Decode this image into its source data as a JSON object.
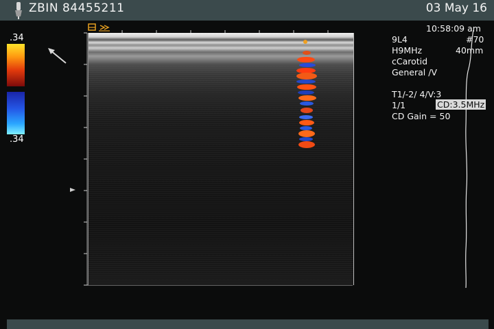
{
  "header": {
    "patient_id": "ZBIN 84455211",
    "date": "03 May 16"
  },
  "color_scale": {
    "top_value": ".34",
    "bottom_value": ".34",
    "hot_colors": [
      "#ffe32a",
      "#ff9a10",
      "#e23a0c",
      "#7c0b0b"
    ],
    "cold_colors": [
      "#1a25a8",
      "#2457e6",
      "#2aa6ff",
      "#7ff0ff"
    ]
  },
  "info_panel": {
    "time": "10:58:09 am",
    "probe": "9L4",
    "frame": "#70",
    "frequency": "H9MHz",
    "depth": "40mm",
    "preset": "cCarotid",
    "application": "General /V",
    "settings": "T1/-2/ 4/V:3",
    "ratio": "1/1",
    "cd_frequency": "CD:3.5MHz",
    "cd_gain": "CD Gain = 50"
  },
  "colors": {
    "header_bar": "#3b4a4c",
    "background": "#0b0c0c",
    "text": "#f2f2f2"
  },
  "icons": {
    "probe": "probe-icon",
    "pointer": "pointer-arrow-icon",
    "orientation": "orientation-icon",
    "depth_marker": "depth-marker-icon"
  }
}
